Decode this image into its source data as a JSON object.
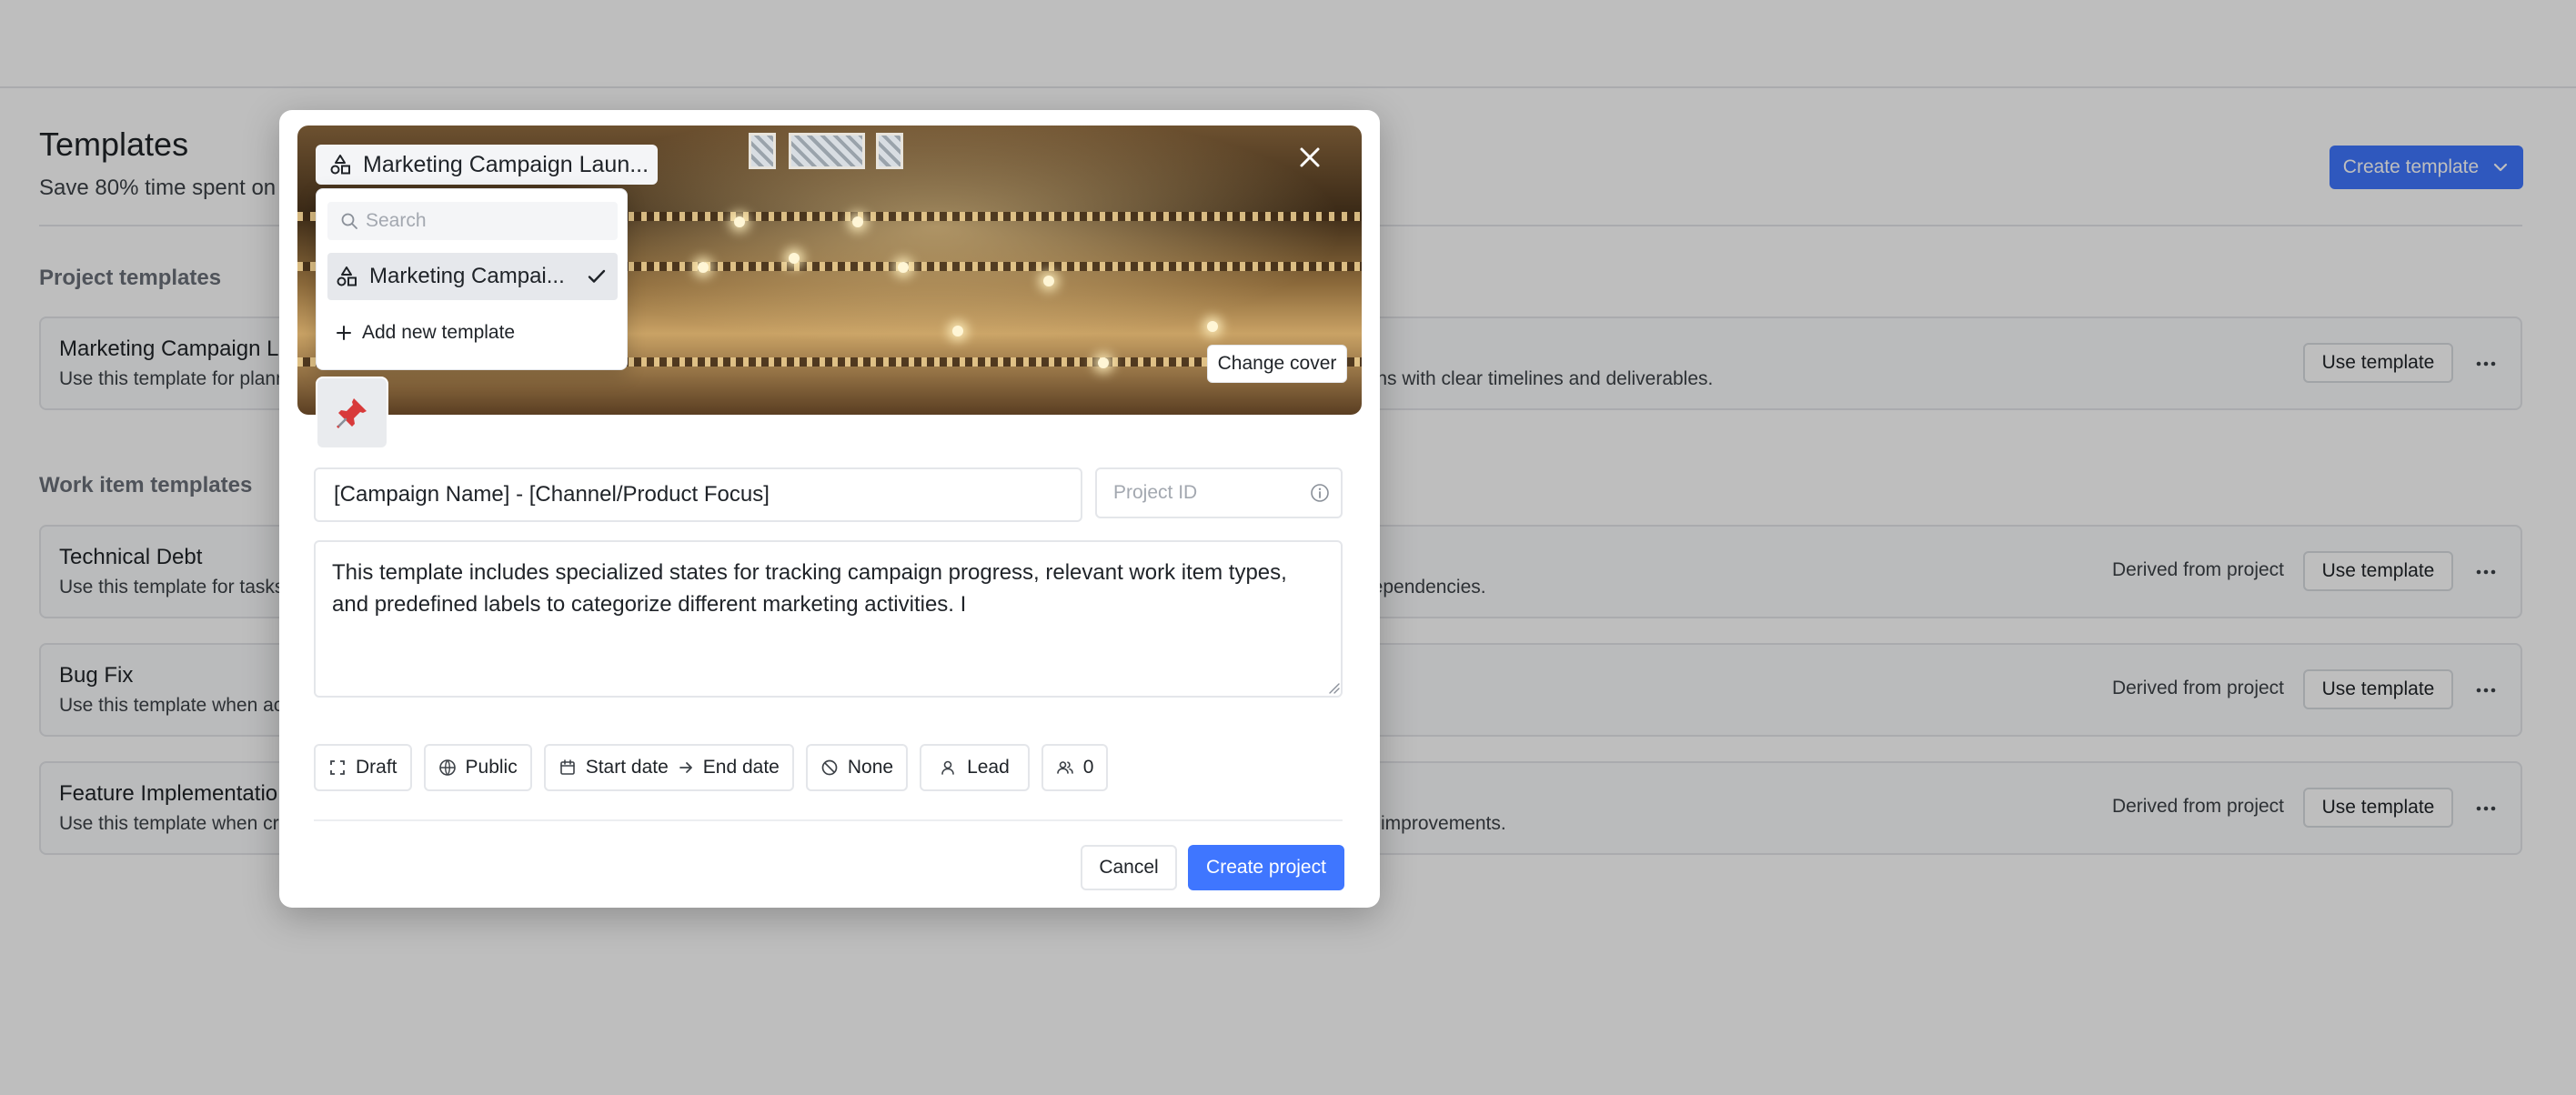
{
  "page": {
    "title": "Templates",
    "subtitle": "Save 80% time spent on c",
    "create_template_label": "Create template"
  },
  "sections": {
    "project": "Project templates",
    "work_item": "Work item templates"
  },
  "project_templates": [
    {
      "name": "Marketing Campaign L",
      "desc_left": "Use this template for plann",
      "desc_right": "igns with clear timelines and deliverables.",
      "use_label": "Use template"
    }
  ],
  "work_item_templates": [
    {
      "name": "Technical Debt",
      "desc_left": "Use this template for tasks",
      "desc_right": "dependencies.",
      "derived": "Derived from project",
      "use_label": "Use template"
    },
    {
      "name": "Bug Fix",
      "desc_left": "Use this template when ac",
      "desc_right": "",
      "derived": "Derived from project",
      "use_label": "Use template"
    },
    {
      "name": "Feature Implementatio",
      "desc_left": "Use this template when cr",
      "desc_right": "improvements.",
      "derived": "Derived from project",
      "use_label": "Use template"
    }
  ],
  "modal": {
    "template_selector": "Marketing Campaign Laun...",
    "change_cover": "Change cover",
    "dropdown": {
      "search_placeholder": "Search",
      "selected_item": "Marketing Campai...",
      "add_new": "Add new template"
    },
    "name_value": "[Campaign Name] - [Channel/Product Focus]",
    "project_id_placeholder": "Project ID",
    "description_value": "This template includes specialized states for tracking campaign progress, relevant work item types, and predefined labels to categorize different marketing activities. I",
    "chips": {
      "state": "Draft",
      "visibility": "Public",
      "start_date": "Start date",
      "end_date": "End date",
      "priority": "None",
      "lead": "Lead",
      "members": "0"
    },
    "cancel_label": "Cancel",
    "create_label": "Create project"
  },
  "colors": {
    "accent": "#3f76ff",
    "overlay": "rgba(0,0,0,0.255)"
  },
  "icons": {
    "template": "template-shapes-icon",
    "emoji": "pushpin-icon"
  }
}
